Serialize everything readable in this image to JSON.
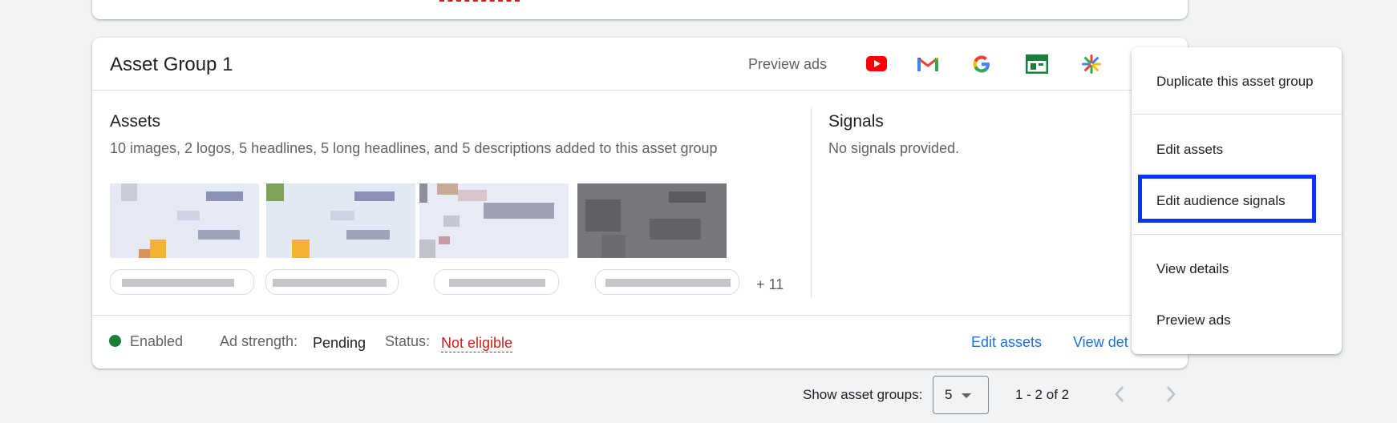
{
  "asset_group": {
    "title": "Asset Group 1",
    "preview_label": "Preview ads",
    "channels": [
      "youtube-icon",
      "gmail-icon",
      "google-icon",
      "display-icon",
      "discover-icon"
    ]
  },
  "assets": {
    "title": "Assets",
    "summary": "10 images, 2 logos, 5 headlines, 5 long headlines, and 5 descriptions added to this asset group",
    "more_count": "+ 11"
  },
  "signals": {
    "title": "Signals",
    "summary": "No signals provided."
  },
  "footer": {
    "enabled_label": "Enabled",
    "ad_strength_label": "Ad strength:",
    "ad_strength_value": "Pending",
    "status_label": "Status:",
    "status_value": "Not eligible",
    "edit_assets_link": "Edit assets",
    "view_details_link": "View det"
  },
  "menu": {
    "items": [
      "Duplicate this asset group",
      "Edit assets",
      "Edit audience signals",
      "View details",
      "Preview ads"
    ],
    "highlighted": "Edit audience signals"
  },
  "pager": {
    "show_label": "Show asset groups:",
    "page_size": "5",
    "range": "1 - 2 of 2"
  },
  "colors": {
    "accent": "#1a73e8",
    "error": "#c5221f",
    "enabled": "#188038",
    "highlight": "#0b33f5"
  }
}
